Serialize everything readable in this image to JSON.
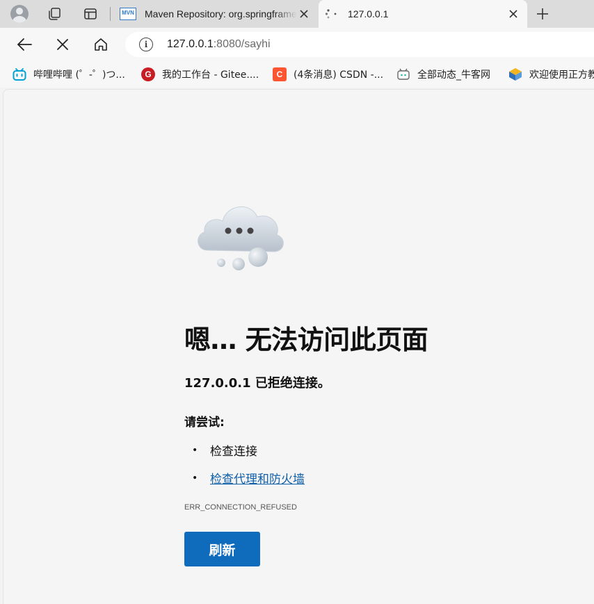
{
  "browser": {
    "tabs": [
      {
        "title": "Maven Repository: org.springframework",
        "favicon": "maven-icon",
        "favicon_text": "MVN",
        "active": false
      },
      {
        "title": "127.0.0.1",
        "favicon": "loading-spinner-icon",
        "active": true
      }
    ],
    "address_bar": {
      "host": "127.0.0.1",
      "path": ":8080/sayhi"
    },
    "bookmarks": [
      {
        "label": "哔哩哔哩 (゜-゜)つ...",
        "icon": "bilibili-icon",
        "color": "#00a1d6"
      },
      {
        "label": "我的工作台 - Gitee....",
        "icon": "gitee-icon",
        "color": "#c71d23"
      },
      {
        "label": "(4条消息) CSDN -...",
        "icon": "csdn-icon",
        "color": "#fc5531"
      },
      {
        "label": "全部动态_牛客网",
        "icon": "nowcoder-icon",
        "color": "#25bb9b"
      },
      {
        "label": "欢迎使用正方教",
        "icon": "zfsoft-icon",
        "color": "#2f6fb8"
      }
    ],
    "bookmark_icon_text": {
      "gitee": "G",
      "csdn": "C"
    }
  },
  "error_page": {
    "title": "嗯… 无法访问此页面",
    "subtitle": "127.0.0.1 已拒绝连接。",
    "try_heading": "请尝试:",
    "suggestions": [
      {
        "text": "检查连接",
        "link": false
      },
      {
        "text": "检查代理和防火墙",
        "link": true
      }
    ],
    "error_code": "ERR_CONNECTION_REFUSED",
    "refresh_label": "刷新",
    "accent_color": "#0f6cbd",
    "link_color": "#0f5fa8"
  }
}
